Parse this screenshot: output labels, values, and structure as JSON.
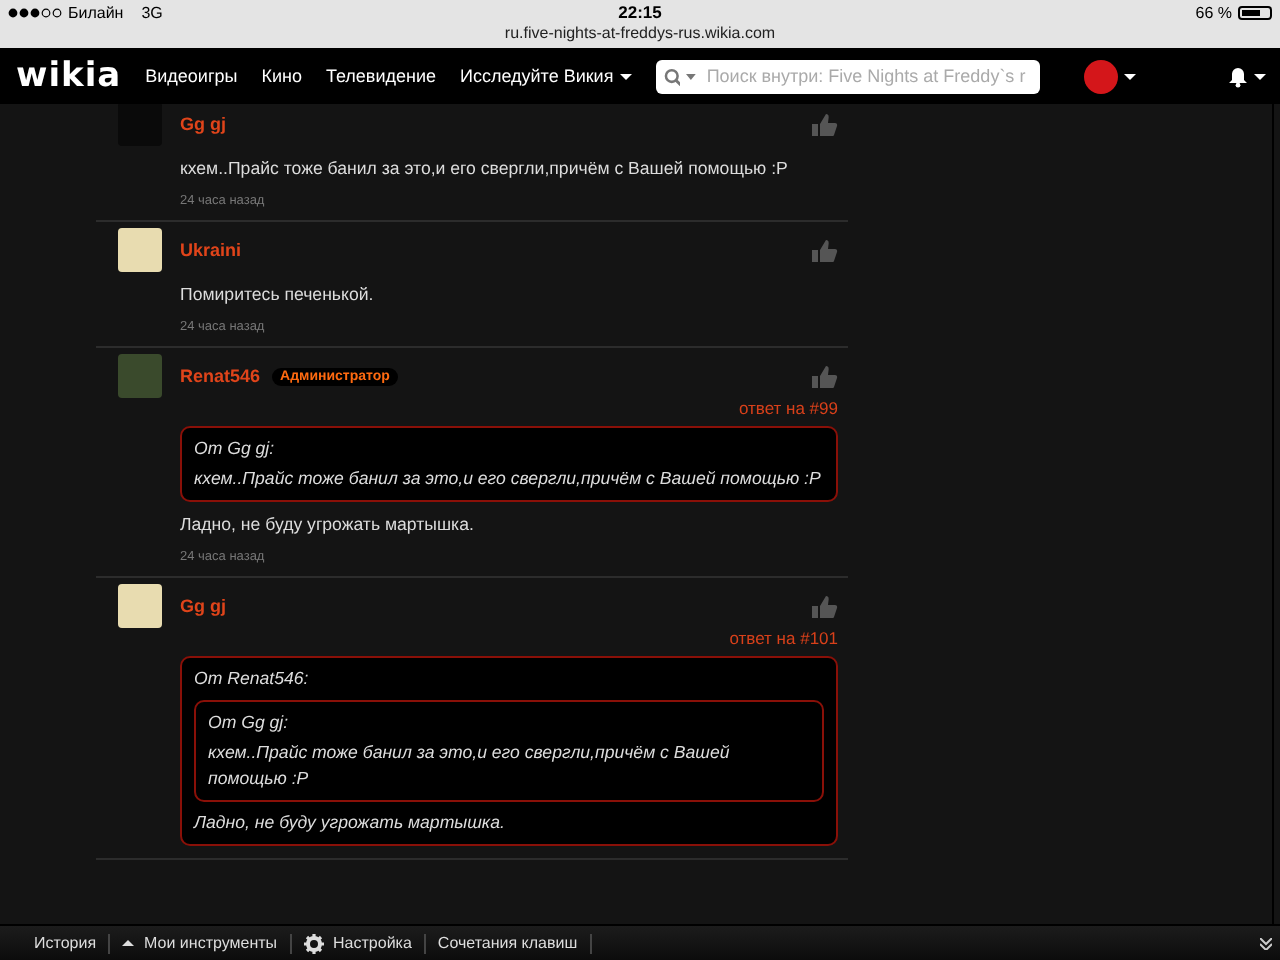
{
  "status_bar": {
    "carrier": "Билайн",
    "network": "3G",
    "time": "22:15",
    "battery": "66 %",
    "url": "ru.five-nights-at-freddys-rus.wikia.com"
  },
  "navbar": {
    "logo": "wikia",
    "links": [
      {
        "label": "Видеоигры",
        "dropdown": false
      },
      {
        "label": "Кино",
        "dropdown": false
      },
      {
        "label": "Телевидение",
        "dropdown": false
      },
      {
        "label": "Исследуйте Викия",
        "dropdown": true
      }
    ],
    "search": {
      "placeholder": "Поиск внутри: Five Nights at Freddy`s r"
    }
  },
  "comments": [
    {
      "author": "Gg gj",
      "text": "кхем..Прайс тоже банил за это,и его свергли,причём с Вашей помощью :P",
      "time": "24 часа назад"
    },
    {
      "author": "Ukraini",
      "text": "Помиритесь печенькой.",
      "time": "24 часа назад"
    },
    {
      "author": "Renat546",
      "badge": "Администратор",
      "reply_to": "ответ на #99",
      "quote": {
        "from": "От Gg gj:",
        "text": "кхем..Прайс тоже банил за это,и его свергли,причём с Вашей помощью :P"
      },
      "text": "Ладно, не буду угрожать мартышка.",
      "time": "24 часа назад"
    },
    {
      "author": "Gg gj",
      "reply_to": "ответ на #101",
      "quote": {
        "from": "От Renat546:",
        "quote": {
          "from": "От Gg gj:",
          "text": "кхем..Прайс тоже банил за это,и его свергли,причём с Вашей помощью :P"
        },
        "text": "Ладно, не буду угрожать мартышка."
      }
    }
  ],
  "toolbar": {
    "items": [
      {
        "label": "История",
        "kind": "plain"
      },
      {
        "label": "Мои инструменты",
        "kind": "menu"
      },
      {
        "label": "Настройка",
        "kind": "settings"
      },
      {
        "label": "Сочетания клавиш",
        "kind": "plain"
      }
    ]
  }
}
